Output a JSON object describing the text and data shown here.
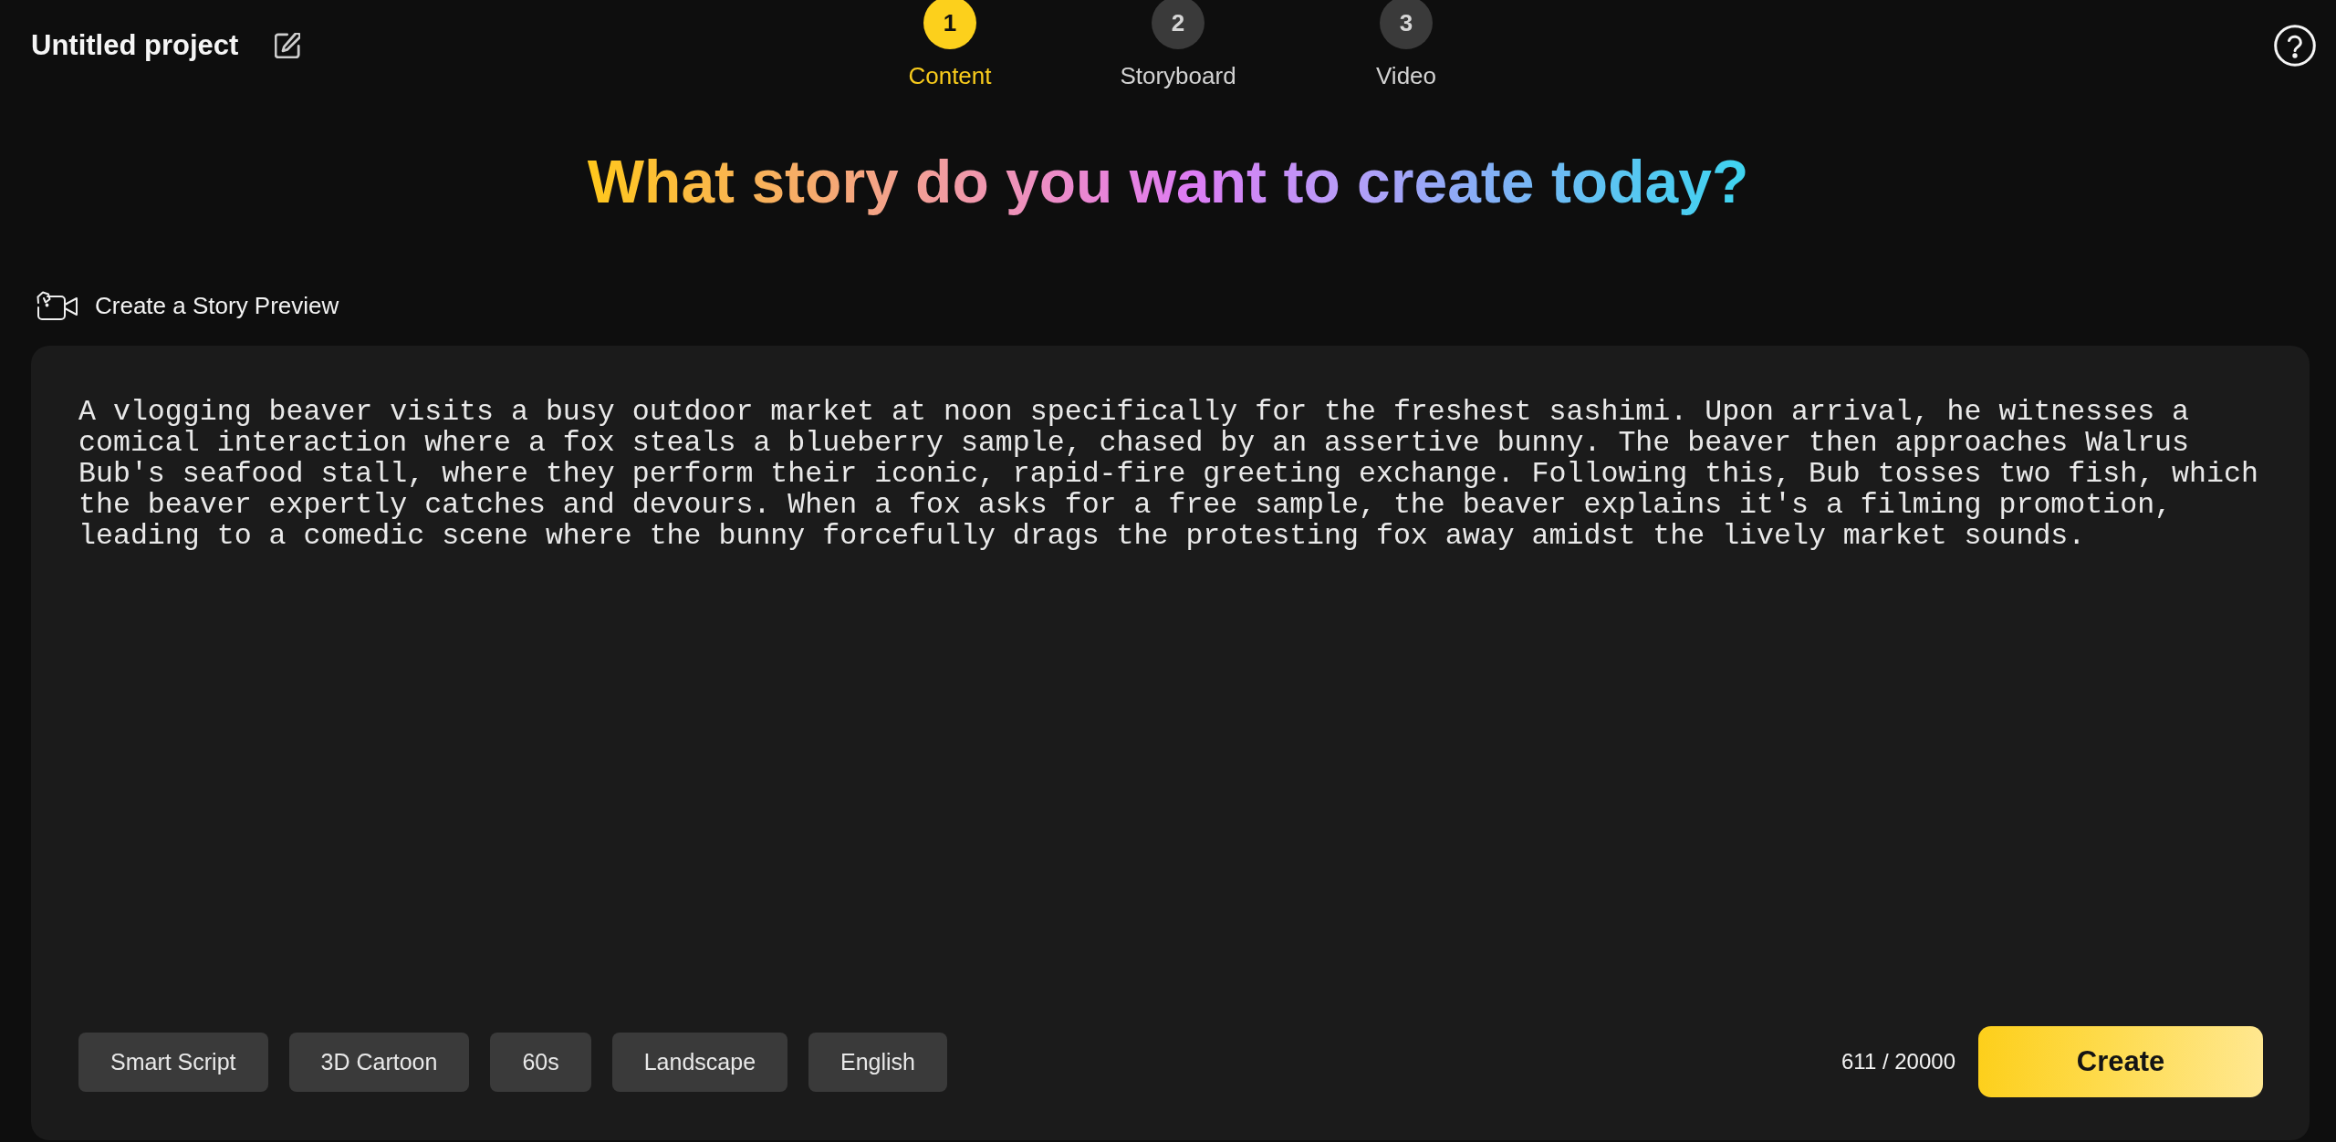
{
  "header": {
    "project_title": "Untitled project"
  },
  "steps": [
    {
      "number": "1",
      "label": "Content",
      "selected": true
    },
    {
      "number": "2",
      "label": "Storyboard",
      "selected": false
    },
    {
      "number": "3",
      "label": "Video",
      "selected": false
    }
  ],
  "headline": "What story do you want to create today?",
  "section": {
    "label": "Create a Story Preview"
  },
  "prompt": {
    "value": "A vlogging beaver visits a busy outdoor market at noon specifically for the freshest sashimi. Upon arrival, he witnesses a comical interaction where a fox steals a blueberry sample, chased by an assertive bunny. The beaver then approaches Walrus Bub's seafood stall, where they perform their iconic, rapid-fire greeting exchange. Following this, Bub tosses two fish, which the beaver expertly catches and devours. When a fox asks for a free sample, the beaver explains it's a filming promotion, leading to a comedic scene where the bunny forcefully drags the protesting fox away amidst the lively market sounds.",
    "options": [
      "Smart Script",
      "3D Cartoon",
      "60s",
      "Landscape",
      "English"
    ],
    "counter": "611 / 20000",
    "create_button": "Create"
  }
}
